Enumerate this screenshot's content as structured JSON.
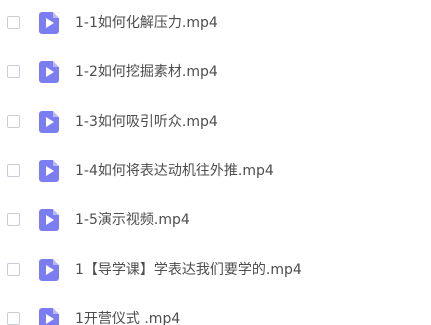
{
  "files": [
    {
      "name": "1-1如何化解压力.mp4",
      "icon": "video-file-icon"
    },
    {
      "name": "1-2如何挖掘素材.mp4",
      "icon": "video-file-icon"
    },
    {
      "name": "1-3如何吸引听众.mp4",
      "icon": "video-file-icon"
    },
    {
      "name": "1-4如何将表达动机往外推.mp4",
      "icon": "video-file-icon"
    },
    {
      "name": "1-5演示视频.mp4",
      "icon": "video-file-icon"
    },
    {
      "name": "1【导学课】学表达我们要学的.mp4",
      "icon": "video-file-icon"
    },
    {
      "name": "1开营仪式 .mp4",
      "icon": "video-file-icon"
    }
  ],
  "colors": {
    "icon": "#7b7ef2",
    "checkbox_border": "#c9ccd4",
    "text": "#4d4d4d",
    "background": "#ffffff"
  }
}
